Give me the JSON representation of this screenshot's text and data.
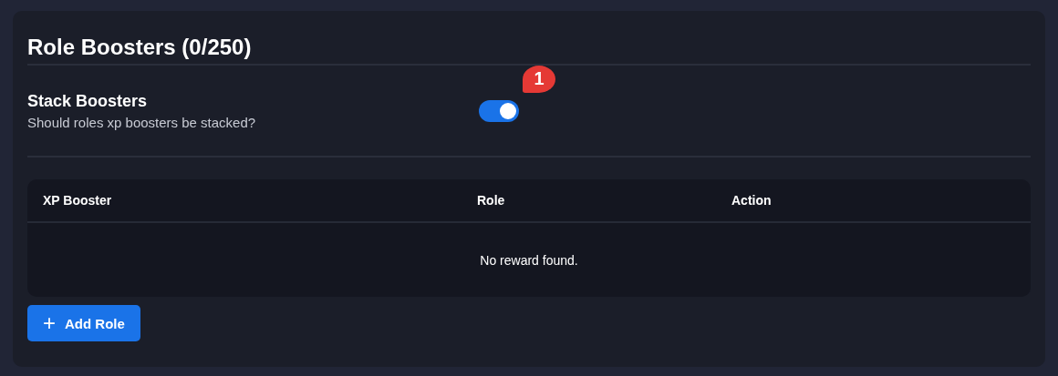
{
  "panel": {
    "title": "Role Boosters (0/250)"
  },
  "setting": {
    "label": "Stack Boosters",
    "description": "Should roles xp boosters be stacked?",
    "on": true,
    "badge": "1"
  },
  "table": {
    "columns": [
      "XP Booster",
      "Role",
      "Action"
    ],
    "empty_message": "No reward found."
  },
  "add_button": {
    "icon": "+",
    "label": "Add Role"
  }
}
